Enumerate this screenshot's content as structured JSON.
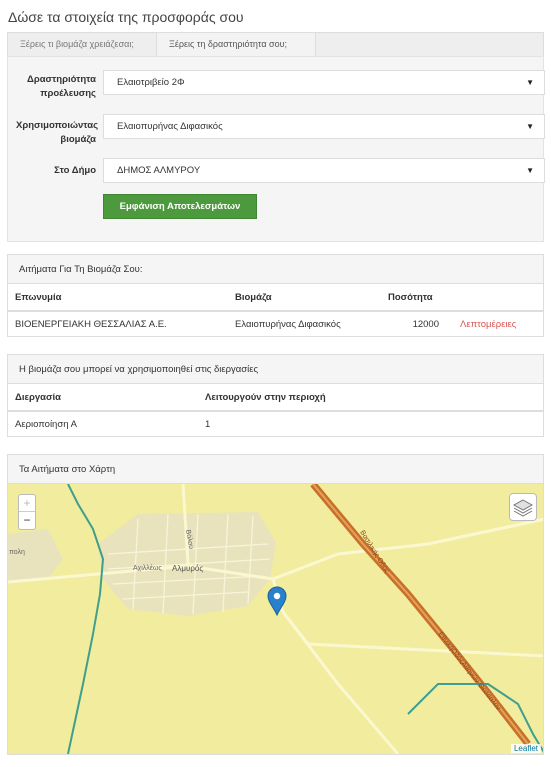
{
  "page": {
    "title": "Δώσε τα στοιχεία της προσφοράς σου"
  },
  "tabs": [
    {
      "label": "Ξέρεις τι βιομάζα χρειάζεσαι;"
    },
    {
      "label": "Ξέρεις τη δραστηριότητα σου;"
    }
  ],
  "form": {
    "activity": {
      "label_line1": "Δραστηριότητα",
      "label_line2": "προέλευσης",
      "value": "Ελαιοτριβείο 2Φ"
    },
    "biomass": {
      "label_line1": "Χρησιμοποιώντας",
      "label_line2": "βιομάζα",
      "value": "Ελαιοπυρήνας Διφασικός"
    },
    "municipality": {
      "label": "Στο Δήμο",
      "value": "ΔΗΜΟΣ ΑΛΜΥΡΟΥ"
    },
    "caret": "▼",
    "submit_label": "Εμφάνιση Αποτελεσμάτων"
  },
  "requests_panel": {
    "title": "Αιτήματα Για Τη Βιομάζα Σου:",
    "columns": [
      "Επωνυμία",
      "Βιομάζα",
      "Ποσότητα",
      ""
    ],
    "rows": [
      {
        "name": "ΒΙΟΕΝΕΡΓΕΙΑΚΗ ΘΕΣΣΑΛΙΑΣ Α.Ε.",
        "biomass": "Ελαιοπυρήνας Διφασικός",
        "quantity": "12000",
        "link": "Λεπτομέρειες"
      }
    ]
  },
  "process_panel": {
    "title": "Η βιομάζα σου μπορεί να χρησιμοποιηθεί στις διεργασίες",
    "columns": [
      "Διεργασία",
      "Λειτουργούν στην περιοχή"
    ],
    "rows": [
      {
        "process": "Αεριοποίηση Α",
        "count": "1"
      }
    ]
  },
  "map_panel": {
    "title": "Τα Αιτήματα στο Χάρτη",
    "zoom_in": "+",
    "zoom_out": "−",
    "attribution": "Leaflet",
    "labels": {
      "town": "Αλμυρός",
      "street1": "Αχιλλέως",
      "street2": "Βόλου",
      "road1": "Βασιλικής Οδός",
      "road2": "ΕθνικήΟδόςΑθηνών-Θεσσαλον",
      "place": "πολη"
    },
    "colors": {
      "land": "#f2ec9f",
      "highway": "#c8702a",
      "boundary": "#3f9e8c",
      "marker": "#2a81cb"
    }
  }
}
